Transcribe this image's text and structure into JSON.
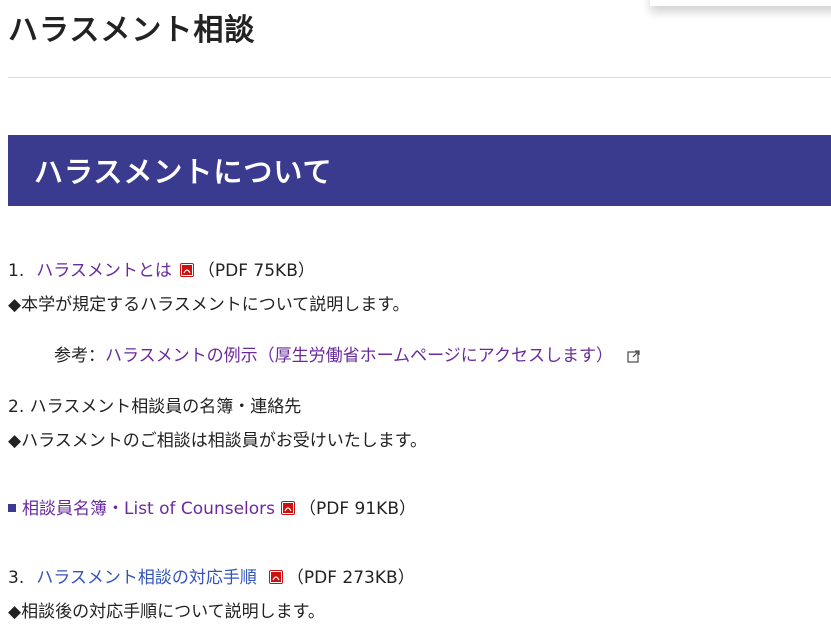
{
  "page": {
    "title": "ハラスメント相談"
  },
  "section": {
    "title": "ハラスメントについて"
  },
  "item1": {
    "number": "1.",
    "link": "ハラスメントとは",
    "size": "（PDF 75KB）",
    "description": "◆本学が規定するハラスメントについて説明します。"
  },
  "reference": {
    "label": "参考：",
    "link": "ハラスメントの例示（厚生労働省ホームページにアクセスします）"
  },
  "item2": {
    "text": "2. ハラスメント相談員の名簿・連絡先",
    "description": "◆ハラスメントのご相談は相談員がお受けいたします。"
  },
  "counselors": {
    "link": "相談員名簿・List of Counselors",
    "size": "（PDF 91KB）"
  },
  "item3": {
    "number": "3.",
    "link": "ハラスメント相談の対応手順",
    "size": "（PDF 273KB）",
    "description": "◆相談後の対応手順について説明します。"
  },
  "colors": {
    "banner": "#3a3a8e",
    "link_purple": "#6a2a9e",
    "link_blue": "#3355bb",
    "pdf_red": "#cc1111"
  },
  "icons": [
    "pdf-icon",
    "external-link-icon",
    "square-bullet-icon"
  ]
}
